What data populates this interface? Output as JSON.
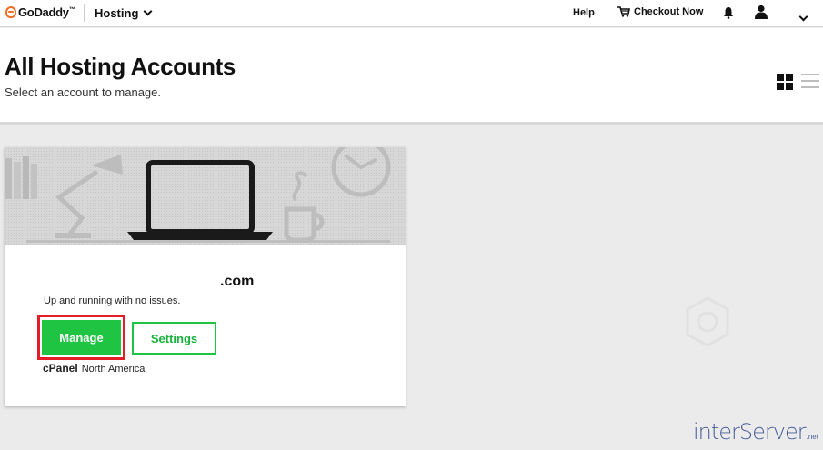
{
  "topbar": {
    "brand": "GoDaddy",
    "brand_tm": "™",
    "product_menu": "Hosting",
    "help": "Help",
    "checkout": "Checkout Now"
  },
  "header": {
    "title": "All Hosting Accounts",
    "subtitle": "Select an account to manage."
  },
  "account_card": {
    "domain": ".com",
    "status": "Up and running with no issues.",
    "manage_label": "Manage",
    "settings_label": "Settings",
    "plan_type": "cPanel",
    "region": "North America"
  },
  "watermark": {
    "text": "interServer",
    "suffix": ".net"
  },
  "colors": {
    "brand_orange": "#f26d21",
    "primary_green": "#20c443",
    "highlight_red": "#e41e26",
    "page_bg": "#ebebeb"
  },
  "icons": {
    "cart": "cart-icon",
    "bell": "bell-icon",
    "user": "user-icon",
    "grid": "grid-view-icon",
    "list": "list-view-icon"
  }
}
